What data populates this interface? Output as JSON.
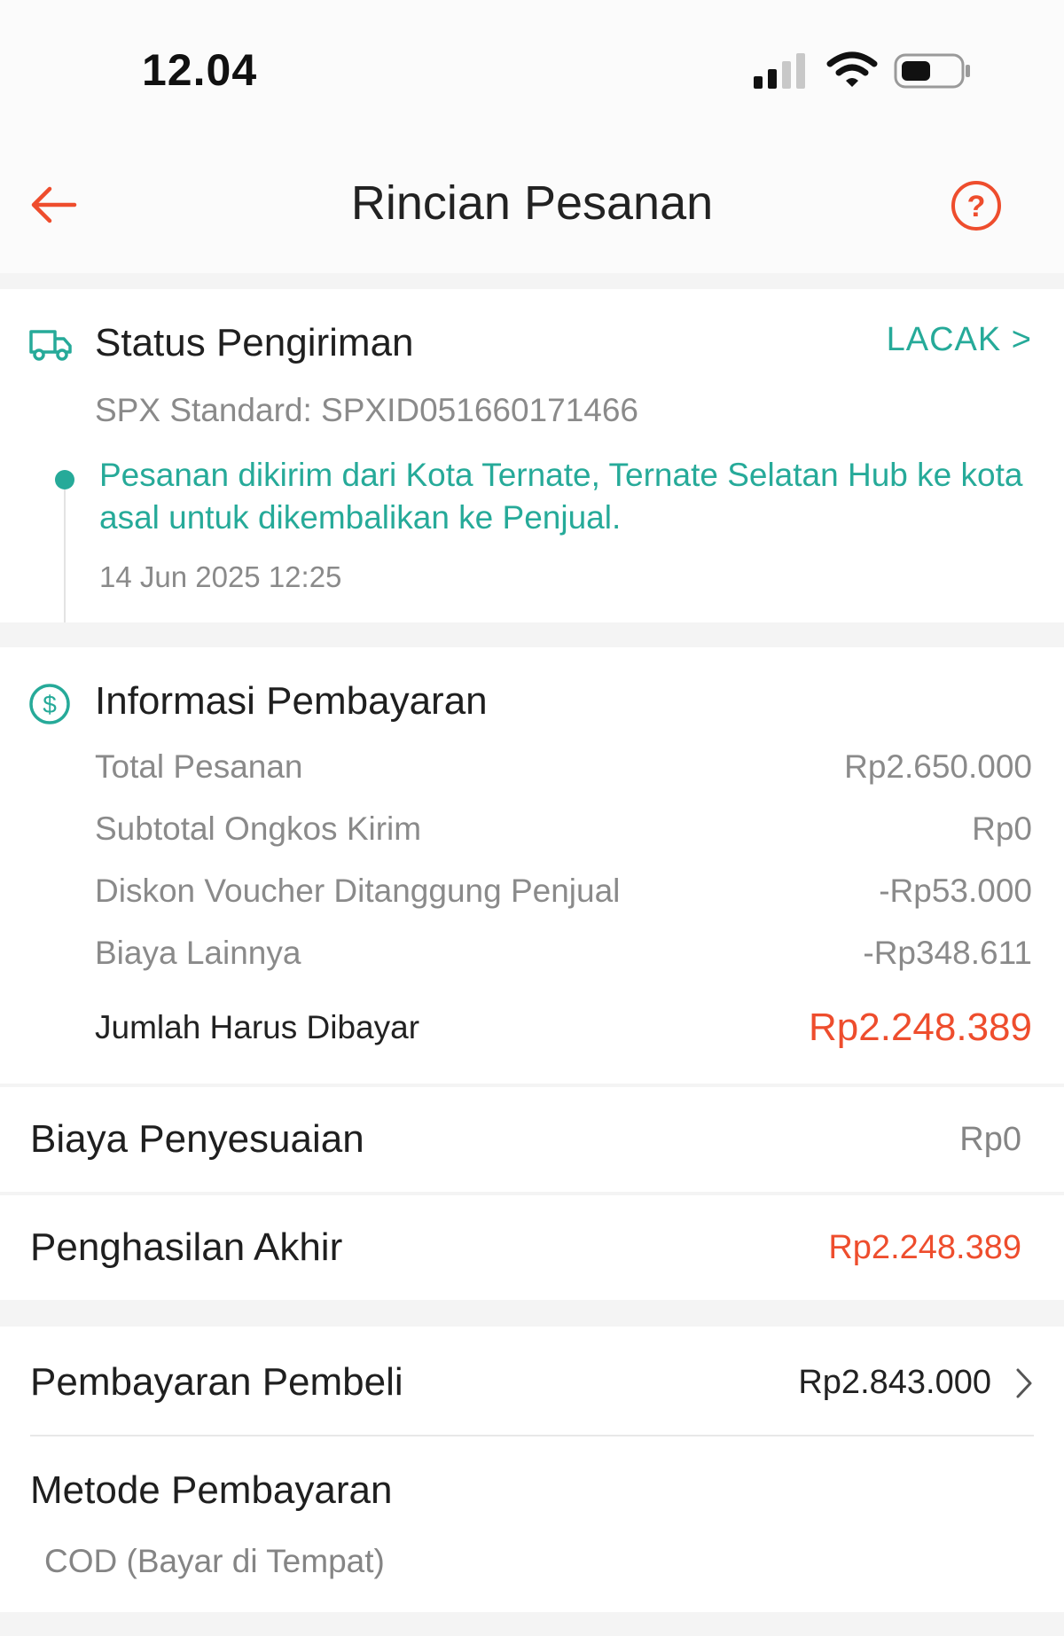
{
  "status_bar": {
    "time": "12.04"
  },
  "header": {
    "title": "Rincian Pesanan"
  },
  "shipping": {
    "title": "Status Pengiriman",
    "track_label": "LACAK >",
    "code": "SPX Standard: SPXID051660171466",
    "message": "Pesanan dikirim dari Kota Ternate, Ternate Selatan Hub ke kota asal untuk dikembalikan ke Penjual.",
    "timestamp": "14 Jun 2025 12:25"
  },
  "payment": {
    "title": "Informasi Pembayaran",
    "rows": [
      {
        "label": "Total Pesanan",
        "value": "Rp2.650.000"
      },
      {
        "label": "Subtotal Ongkos Kirim",
        "value": "Rp0"
      },
      {
        "label": "Diskon Voucher Ditanggung Penjual",
        "value": "-Rp53.000"
      },
      {
        "label": "Biaya Lainnya",
        "value": "-Rp348.611"
      }
    ],
    "total_label": "Jumlah Harus Dibayar",
    "total_value": "Rp2.248.389"
  },
  "adjustment": {
    "label": "Biaya Penyesuaian",
    "value": "Rp0"
  },
  "final_income": {
    "label": "Penghasilan Akhir",
    "value": "Rp2.248.389"
  },
  "buyer_payment": {
    "label": "Pembayaran Pembeli",
    "value": "Rp2.843.000"
  },
  "payment_method": {
    "label": "Metode Pembayaran",
    "value": "COD (Bayar di Tempat)"
  },
  "colors": {
    "accent": "#ee4d2d",
    "teal": "#26aa99"
  }
}
